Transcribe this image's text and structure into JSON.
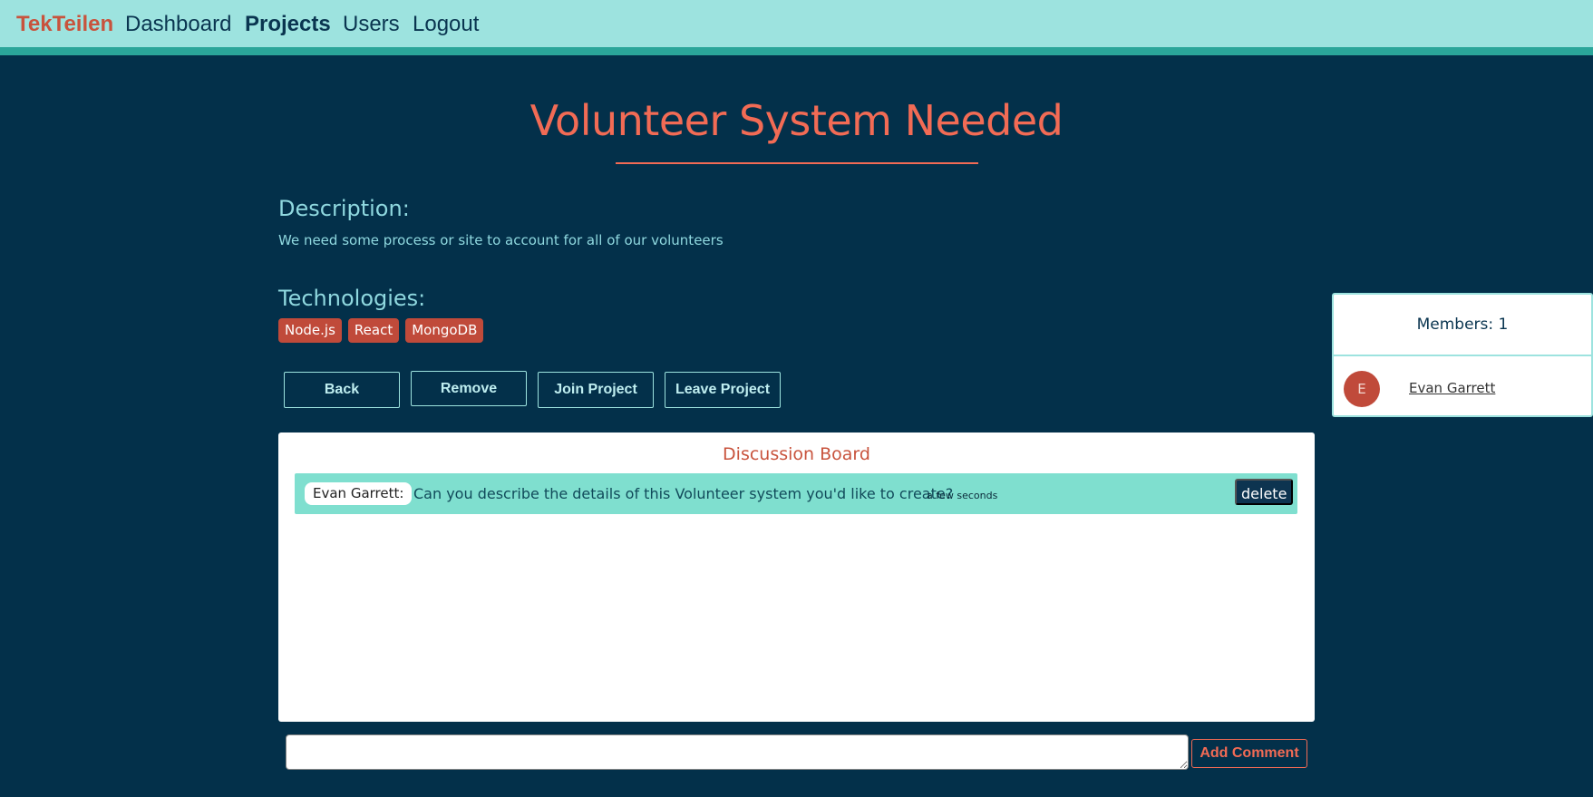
{
  "colors": {
    "navbar_bg": "#9de3df",
    "navbar_border": "#2ba69a",
    "page_bg": "#03304a",
    "accent": "#f26b55",
    "badge": "#c04a3a",
    "comment_bg": "#7fdfcf"
  },
  "nav": {
    "brand": "TekTeilen",
    "links": [
      "Dashboard",
      "Projects",
      "Users",
      "Logout"
    ],
    "active": "Projects"
  },
  "project": {
    "title": "Volunteer System Needed",
    "description_heading": "Description:",
    "description": "We need some process or site to account for all of our volunteers",
    "technologies_heading": "Technologies:",
    "technologies": [
      "Node.js",
      "React",
      "MongoDB"
    ]
  },
  "actions": {
    "back": "Back",
    "remove": "Remove",
    "join": "Join Project",
    "leave": "Leave Project"
  },
  "board": {
    "title": "Discussion Board",
    "comments": [
      {
        "author": "Evan Garrett:",
        "text": "Can you describe the details of this Volunteer system you'd like to create?",
        "time": "a few seconds",
        "delete_label": "delete"
      }
    ],
    "input_value": "",
    "add_comment_label": "Add Comment"
  },
  "members": {
    "header": "Members: 1",
    "list": [
      {
        "initial": "E",
        "name": "Evan Garrett"
      }
    ]
  }
}
